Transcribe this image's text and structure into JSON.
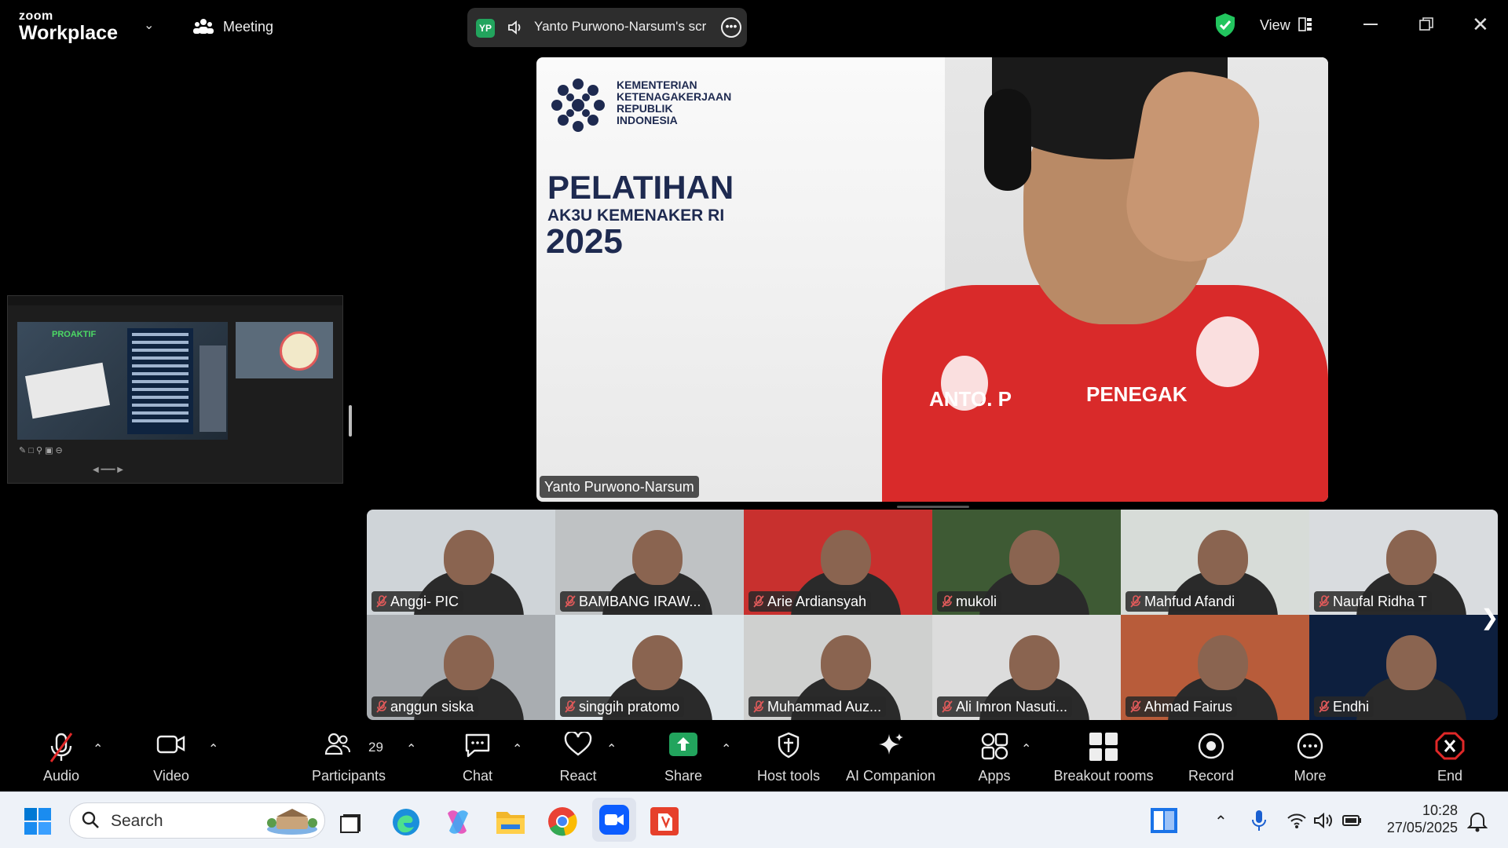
{
  "titlebar": {
    "brand_small": "zoom",
    "brand_big": "Workplace",
    "meeting_label": "Meeting",
    "share_badge": "YP",
    "share_text": "Yanto Purwono-Narsum's scr",
    "view_label": "View"
  },
  "main_video": {
    "org_lines": [
      "KEMENTERIAN",
      "KETENAGAKERJAAN",
      "REPUBLIK",
      "INDONESIA"
    ],
    "title_line1": "PELATIHAN",
    "title_line2": "AK3U KEMENAKER RI",
    "title_line3": "2025",
    "shirt_text1": "ANTO. P",
    "shirt_text2": "PENEGAK",
    "speaker_name": "Yanto Purwono-Narsum"
  },
  "shared_thumbnail": {
    "slide_title": "PROAKTIF"
  },
  "participants": [
    {
      "name": "Anggi- PIC",
      "bg": "#cfd4d8"
    },
    {
      "name": "BAMBANG IRAW...",
      "bg": "#bfc2c4"
    },
    {
      "name": "Arie Ardiansyah",
      "bg": "#c8302e"
    },
    {
      "name": "mukoli",
      "bg": "#3e5a34"
    },
    {
      "name": "Mahfud Afandi",
      "bg": "#d7dcd8"
    },
    {
      "name": "Naufal Ridha T",
      "bg": "#d9dcdf"
    },
    {
      "name": "anggun siska",
      "bg": "#a9adb1"
    },
    {
      "name": "singgih pratomo",
      "bg": "#dfe6ea"
    },
    {
      "name": "Muhammad Auz...",
      "bg": "#cfd0cf"
    },
    {
      "name": "Ali Imron Nasuti...",
      "bg": "#dcdcdc"
    },
    {
      "name": "Ahmad Fairus",
      "bg": "#b85c3a"
    },
    {
      "name": "Endhi",
      "bg": "#0d1f3e"
    }
  ],
  "toolbar": {
    "audio": "Audio",
    "video": "Video",
    "participants": "Participants",
    "participant_count": "29",
    "chat": "Chat",
    "react": "React",
    "share": "Share",
    "host_tools": "Host tools",
    "ai_companion": "AI Companion",
    "apps": "Apps",
    "breakout": "Breakout rooms",
    "record": "Record",
    "more": "More",
    "end": "End"
  },
  "taskbar": {
    "search_placeholder": "Search",
    "time": "10:28",
    "date": "27/05/2025"
  },
  "colors": {
    "zoom_blue": "#0b5cff",
    "share_green": "#22a45d",
    "end_red": "#e02828",
    "muted_red": "#e05a5a"
  }
}
